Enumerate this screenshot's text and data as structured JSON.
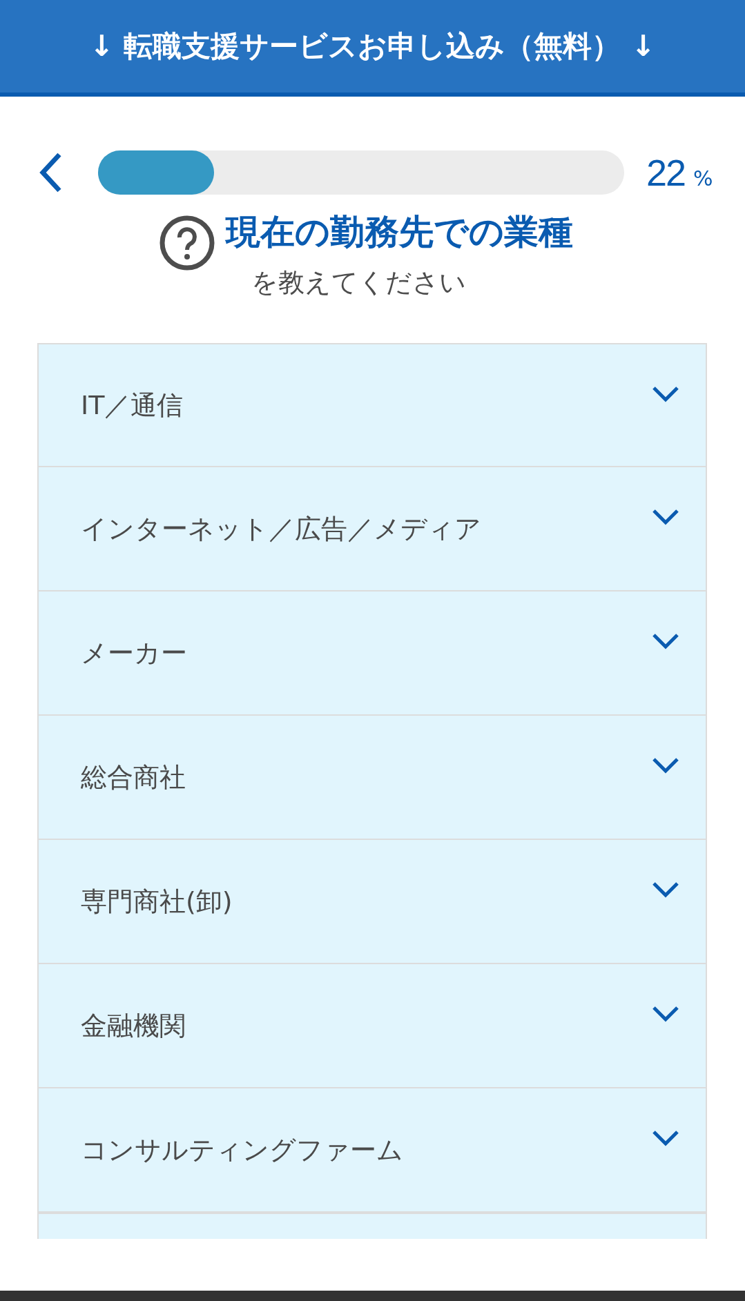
{
  "banner": {
    "title": "↓ 転職支援サービスお申し込み（無料） ↓"
  },
  "progress": {
    "level": 0.22,
    "value": "22",
    "unit": "%"
  },
  "question": {
    "title": "現在の勤務先での業種",
    "subtitle": "を教えてください"
  },
  "options": [
    {
      "label": "IT／通信",
      "expanded": false
    },
    {
      "label": "インターネット／広告／メディア",
      "expanded": false
    },
    {
      "label": "メーカー",
      "expanded": false
    },
    {
      "label": "総合商社",
      "expanded": false
    },
    {
      "label": "専門商社(卸)",
      "expanded": false
    },
    {
      "label": "金融機関",
      "expanded": false
    },
    {
      "label": "コンサルティングファーム",
      "expanded": false
    }
  ]
}
